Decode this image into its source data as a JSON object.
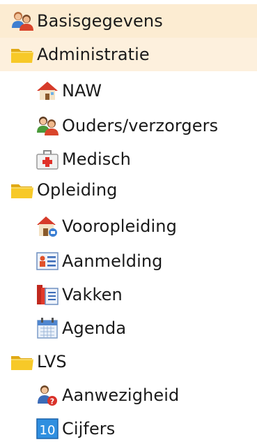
{
  "tree": {
    "items": [
      {
        "label": "Basisgegevens",
        "icon": "people-icon",
        "level": 0,
        "highlighted": true
      },
      {
        "label": "Administratie",
        "icon": "folder-icon",
        "level": 0,
        "highlighted": true
      },
      {
        "label": "NAW",
        "icon": "house-icon",
        "level": 1
      },
      {
        "label": "Ouders/verzorgers",
        "icon": "people-icon",
        "level": 1
      },
      {
        "label": "Medisch",
        "icon": "first-aid-kit-icon",
        "level": 1
      },
      {
        "label": "Opleiding",
        "icon": "folder-icon",
        "level": 0
      },
      {
        "label": "Vooropleiding",
        "icon": "house-icon",
        "level": 1
      },
      {
        "label": "Aanmelding",
        "icon": "registration-form-icon",
        "level": 1
      },
      {
        "label": "Vakken",
        "icon": "books-icon",
        "level": 1
      },
      {
        "label": "Agenda",
        "icon": "calendar-icon",
        "level": 1
      },
      {
        "label": "LVS",
        "icon": "folder-icon",
        "level": 0
      },
      {
        "label": "Aanwezigheid",
        "icon": "attendance-person-icon",
        "level": 1
      },
      {
        "label": "Cijfers",
        "icon": "grades-icon",
        "level": 1
      }
    ],
    "grades_icon_text": "10"
  },
  "colors": {
    "highlight": "#fdf0dd",
    "folder": "#f7c928",
    "text": "#1a1a1a"
  }
}
